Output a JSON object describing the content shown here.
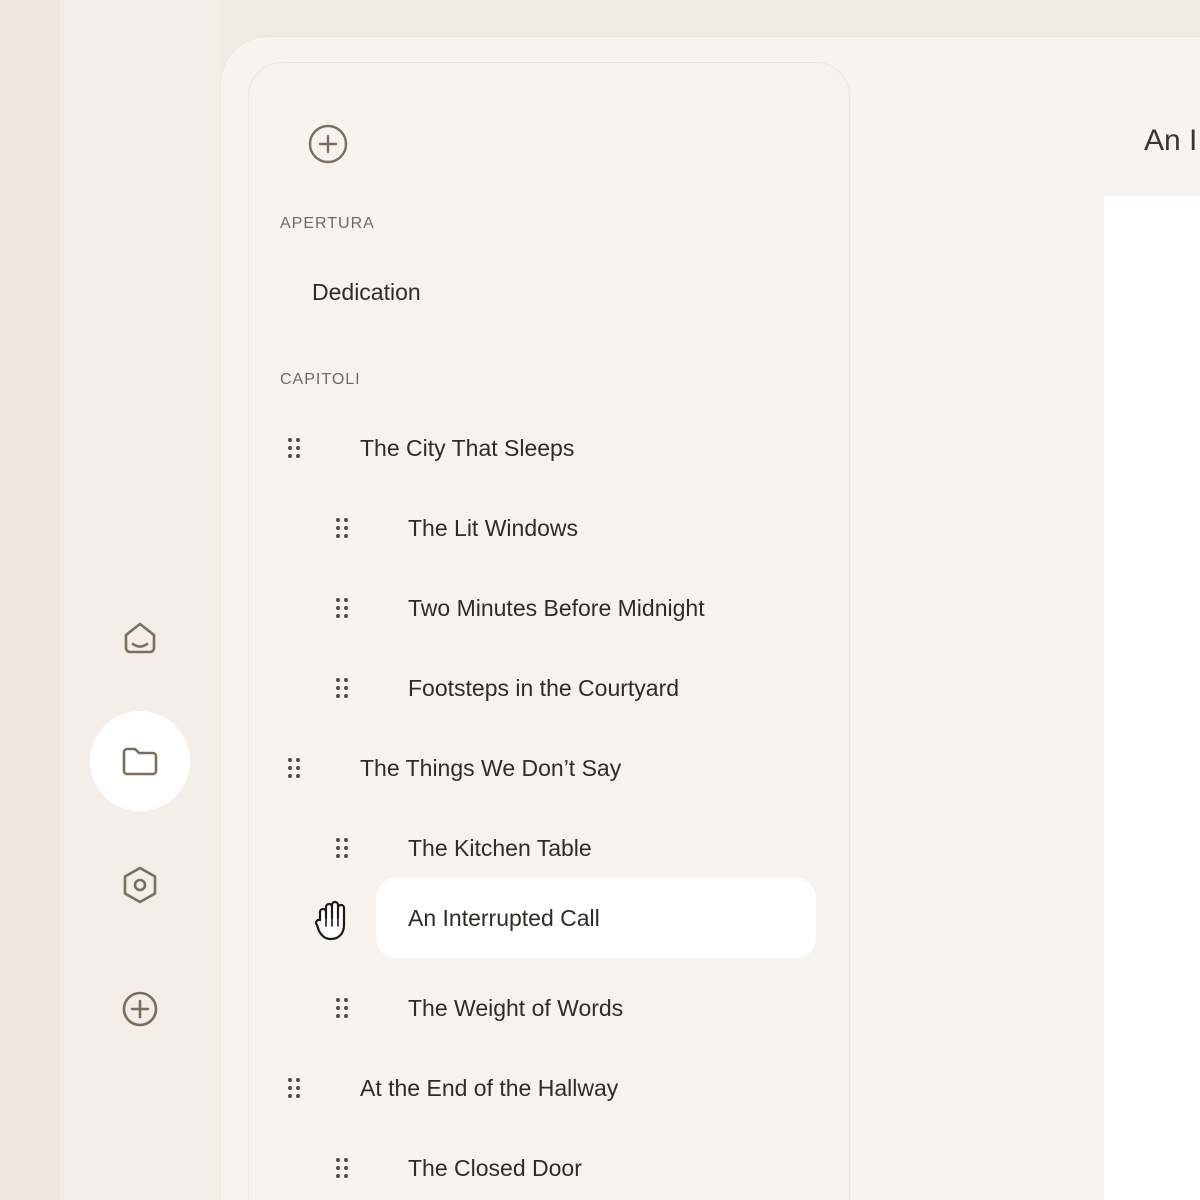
{
  "sidebar": {
    "sections": [
      {
        "label": "APERTURA",
        "items": [
          {
            "label": "Dedication",
            "level": 0,
            "draggable": false
          }
        ]
      },
      {
        "label": "CAPITOLI",
        "items": [
          {
            "label": "The City That Sleeps",
            "level": 0,
            "draggable": true
          },
          {
            "label": "The Lit Windows",
            "level": 1,
            "draggable": true
          },
          {
            "label": "Two Minutes Before Midnight",
            "level": 1,
            "draggable": true
          },
          {
            "label": "Footsteps in the Courtyard",
            "level": 1,
            "draggable": true
          },
          {
            "label": "The Things We Don’t Say",
            "level": 0,
            "draggable": true
          },
          {
            "label": "The Kitchen Table",
            "level": 1,
            "draggable": true
          },
          {
            "label": "An Interrupted Call",
            "level": 1,
            "draggable": true,
            "selected": true
          },
          {
            "label": "The Weight of Words",
            "level": 1,
            "draggable": true
          },
          {
            "label": "At the End of the Hallway",
            "level": 0,
            "draggable": true
          },
          {
            "label": "The Closed Door",
            "level": 1,
            "draggable": true
          }
        ]
      }
    ]
  },
  "document": {
    "title": "An I"
  },
  "rail": {
    "items": [
      {
        "icon": "home-icon"
      },
      {
        "icon": "folder-icon",
        "active": true
      },
      {
        "icon": "settings-hexagon-icon"
      },
      {
        "icon": "add-circle-icon"
      }
    ]
  },
  "colors": {
    "background": "#f1ebe4",
    "panel": "#f6f3ee",
    "icon": "#7a6e5e",
    "selected": "#ffffff",
    "text": "#2f2c28"
  }
}
